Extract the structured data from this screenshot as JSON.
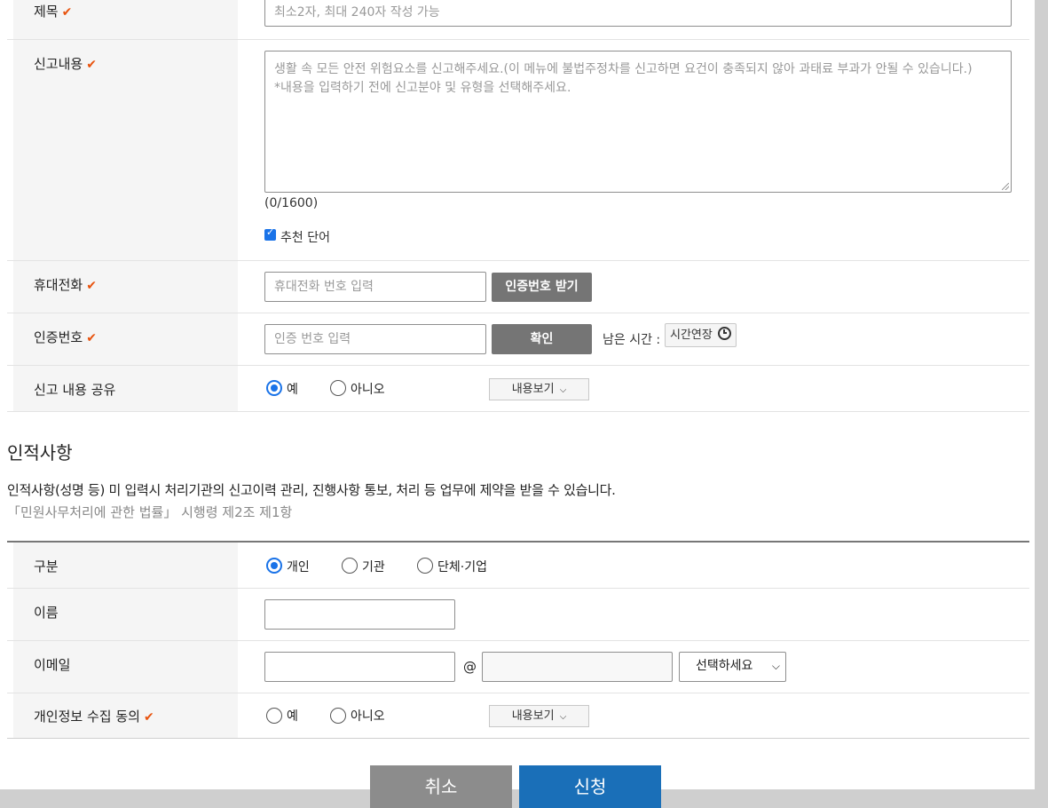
{
  "form": {
    "title_label": "제목",
    "title_placeholder": "최소2자, 최대 240자 작성 가능",
    "content_label": "신고내용",
    "content_placeholder": "생활 속 모든 안전 위험요소를 신고해주세요.(이 메뉴에 불법주정차를 신고하면 요건이 충족되지 않아 과태료 부과가 안될 수 있습니다.)\n*내용을 입력하기 전에 신고분야 및 유형을 선택해주세요.",
    "char_count": "(0/1600)",
    "recommend_label": "추천 단어",
    "recommend_checked": true,
    "phone_label": "휴대전화",
    "phone_placeholder": "휴대전화 번호 입력",
    "phone_button": "인증번호 받기",
    "auth_label": "인증번호",
    "auth_placeholder": "인증 번호 입력",
    "auth_button": "확인",
    "remaining_label": "남은 시간 :",
    "extend_button": "시간연장",
    "share_label": "신고 내용 공유",
    "share_options": [
      "예",
      "아니오"
    ],
    "share_selected": "예",
    "share_view_button": "내용보기"
  },
  "personal": {
    "heading": "인적사항",
    "notice": "인적사항(성명 등) 미 입력시 처리기관의 신고이력 관리, 진행사항 통보, 처리 등 업무에 제약을 받을 수 있습니다.",
    "law": "「민원사무처리에 관한 법률」 시행령 제2조 제1항",
    "type_label": "구분",
    "type_options": [
      "개인",
      "기관",
      "단체·기업"
    ],
    "type_selected": "개인",
    "name_label": "이름",
    "email_label": "이메일",
    "email_at": "@",
    "email_select": "선택하세요",
    "consent_label": "개인정보 수집 동의",
    "consent_options": [
      "예",
      "아니오"
    ],
    "consent_view_button": "내용보기"
  },
  "actions": {
    "cancel": "취소",
    "submit": "신청"
  },
  "colors": {
    "required_mark": "#e8530e",
    "submit_bg": "#1a6fb8",
    "cancel_bg": "#8c8c8c",
    "radio_on": "#1a73e8"
  }
}
